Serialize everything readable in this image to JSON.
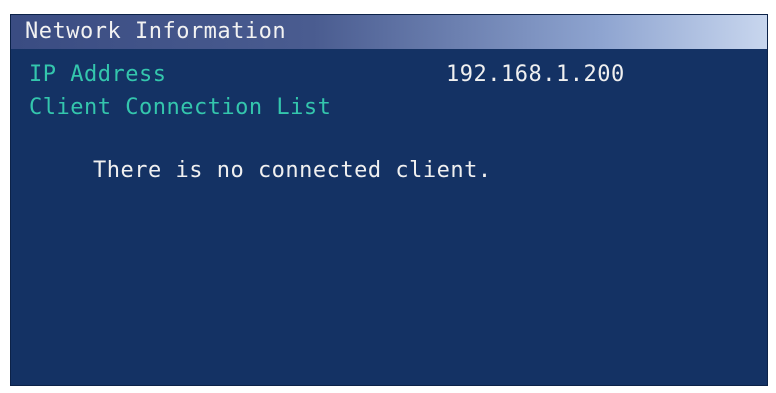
{
  "panel": {
    "title": "Network Information"
  },
  "network": {
    "ip_label": "IP Address",
    "ip_value": "192.168.1.200",
    "client_list_label": "Client Connection List",
    "empty_message": "There is no connected client."
  },
  "colors": {
    "panel_background": "#143264",
    "label_text": "#34c6ad",
    "value_text": "#f0f0f0"
  }
}
